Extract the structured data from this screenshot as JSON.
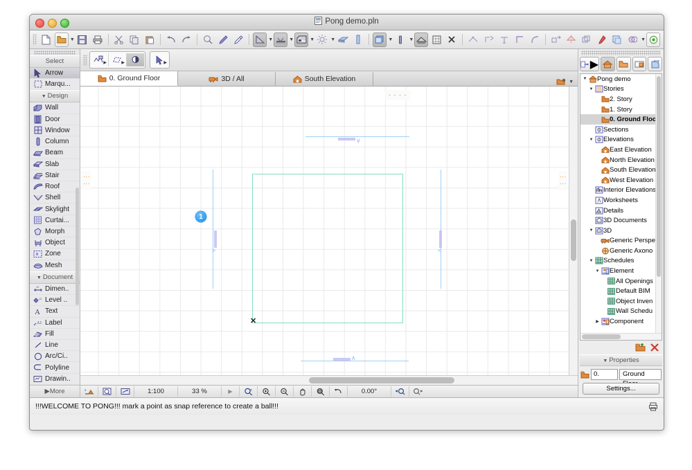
{
  "window": {
    "title": "Pong demo.pln",
    "doc_icon": "document-icon",
    "traffic": {
      "close": "close-button",
      "minimize": "minimize-button",
      "zoom": "zoom-button"
    }
  },
  "toolbar_main": [
    {
      "icon": "new-document-icon",
      "label": "New"
    },
    {
      "icon": "open-folder-icon",
      "label": "Open",
      "has_caret": true,
      "framed": true
    },
    {
      "icon": "save-icon",
      "label": "Save"
    },
    {
      "icon": "print-icon",
      "label": "Print"
    },
    {
      "icon": "scissors-icon",
      "label": "Cut"
    },
    {
      "icon": "copy-icon",
      "label": "Copy"
    },
    {
      "icon": "paste-icon",
      "label": "Paste"
    },
    {
      "icon": "undo-arrow-icon",
      "label": "Undo"
    },
    {
      "icon": "redo-arrow-icon",
      "label": "Redo"
    },
    {
      "icon": "find-select-icon",
      "label": "Find & Select"
    },
    {
      "icon": "pen-icon",
      "label": "Pick Up Parameters"
    },
    {
      "icon": "syringe-icon",
      "label": "Inject Parameters"
    },
    {
      "icon": "measure-icon",
      "label": "Measure",
      "has_caret": true,
      "active": true
    },
    {
      "icon": "dimension-icon",
      "label": "Dimension",
      "has_caret": true,
      "active": true
    },
    {
      "icon": "zone-stamp-icon",
      "label": "Zone",
      "has_caret": true,
      "active": true
    },
    {
      "icon": "sun-icon",
      "label": "Sun Settings",
      "has_caret": true
    },
    {
      "icon": "slab-blue-icon",
      "label": "Slab"
    },
    {
      "icon": "wall-blue-icon",
      "label": "Wall"
    },
    {
      "icon": "stack-3d-icon",
      "label": "3D View",
      "has_caret": true,
      "active": true
    },
    {
      "icon": "column-small-icon",
      "label": "Column",
      "has_caret": true
    },
    {
      "icon": "roof-tool-icon",
      "label": "Roof",
      "active": true
    },
    {
      "icon": "marquee-grid-icon",
      "label": "Marquee"
    },
    {
      "icon": "x-delete-icon",
      "label": "Delete"
    },
    {
      "icon": "trim-icon",
      "label": "Trim"
    },
    {
      "icon": "split-icon",
      "label": "Split"
    },
    {
      "icon": "adjust-icon",
      "label": "Adjust"
    },
    {
      "icon": "corner-icon",
      "label": "Intersect"
    },
    {
      "icon": "fillet-icon",
      "label": "Fillet/Chamfer"
    },
    {
      "icon": "drag-copy-icon",
      "label": "Drag a Copy"
    },
    {
      "icon": "mirror-house-icon",
      "label": "Mirror a Copy"
    },
    {
      "icon": "multiply-icon",
      "label": "Multiply"
    },
    {
      "icon": "pen-marker-icon",
      "label": "Display Order"
    },
    {
      "icon": "group-icon",
      "label": "Group"
    },
    {
      "icon": "solid-ops-icon",
      "label": "Solid Element Operations",
      "has_caret": true
    },
    {
      "icon": "target-green-icon",
      "label": "Align"
    }
  ],
  "mini_toolbar": [
    {
      "icon": "arrow-group-icon",
      "label": "Arrow Group",
      "has_caret": true
    },
    {
      "icon": "polygon-select-icon",
      "label": "Polygon Selection",
      "has_caret": true
    },
    {
      "icon": "fill-hand-icon",
      "label": "Paint Bucket",
      "on": true
    },
    {
      "icon": "cursor-arrow-icon",
      "label": "Arrow Tool",
      "has_caret": true,
      "framed": true
    }
  ],
  "toolbox": {
    "sections": [
      {
        "header": "Select",
        "items": [
          {
            "label": "Arrow",
            "icon": "arrow-cursor-icon",
            "selected": true
          },
          {
            "label": "Marqu...",
            "icon": "marquee-icon"
          }
        ]
      },
      {
        "header": "Design",
        "items": [
          {
            "label": "Wall",
            "icon": "wall-icon"
          },
          {
            "label": "Door",
            "icon": "door-icon"
          },
          {
            "label": "Window",
            "icon": "window-icon"
          },
          {
            "label": "Column",
            "icon": "column-icon"
          },
          {
            "label": "Beam",
            "icon": "beam-icon"
          },
          {
            "label": "Slab",
            "icon": "slab-icon"
          },
          {
            "label": "Stair",
            "icon": "stair-icon"
          },
          {
            "label": "Roof",
            "icon": "roof-icon"
          },
          {
            "label": "Shell",
            "icon": "shell-icon"
          },
          {
            "label": "Skylight",
            "icon": "skylight-icon"
          },
          {
            "label": "Curtai...",
            "icon": "curtain-wall-icon"
          },
          {
            "label": "Morph",
            "icon": "morph-icon"
          },
          {
            "label": "Object",
            "icon": "object-icon"
          },
          {
            "label": "Zone",
            "icon": "zone-icon"
          },
          {
            "label": "Mesh",
            "icon": "mesh-icon"
          }
        ]
      },
      {
        "header": "Document",
        "items": [
          {
            "label": "Dimen..",
            "icon": "dimension-tool-icon"
          },
          {
            "label": "Level ..",
            "icon": "level-dimension-icon"
          },
          {
            "label": "Text",
            "icon": "text-icon"
          },
          {
            "label": "Label",
            "icon": "label-icon"
          },
          {
            "label": "Fill",
            "icon": "fill-icon"
          },
          {
            "label": "Line",
            "icon": "line-icon"
          },
          {
            "label": "Arc/Ci..",
            "icon": "arc-circle-icon"
          },
          {
            "label": "Polyline",
            "icon": "polyline-icon"
          },
          {
            "label": "Drawin..",
            "icon": "drawing-icon"
          }
        ]
      }
    ],
    "more_label": "More"
  },
  "tabs": [
    {
      "label": "0. Ground Floor",
      "icon": "story-icon",
      "active": true
    },
    {
      "label": "3D / All",
      "icon": "camera-3d-icon",
      "active": false
    },
    {
      "label": "South Elevation",
      "icon": "elevation-house-icon",
      "active": false
    }
  ],
  "tab_extra": {
    "icon": "organizer-icon",
    "caret": "chevron-down-icon"
  },
  "canvas": {
    "marker_badge": "1",
    "elevation_marks": [
      "- - - -",
      "- - - -",
      "⋮",
      "⋮"
    ],
    "cursor": "x-snap-cursor"
  },
  "zoombar": {
    "buttons_left": [
      {
        "icon": "elevation-toggle-icon"
      },
      {
        "icon": "quick-layer-icon"
      },
      {
        "icon": "trace-reference-icon"
      }
    ],
    "scale": "1:100",
    "zoom_percent": "33 %",
    "play_icon": "play-triangle-icon",
    "nav_buttons": [
      {
        "icon": "zoom-fit-icon"
      },
      {
        "icon": "zoom-in-icon"
      },
      {
        "icon": "zoom-out-icon"
      },
      {
        "icon": "pan-hand-icon"
      },
      {
        "icon": "fit-in-window-icon"
      },
      {
        "icon": "previous-zoom-icon"
      }
    ],
    "orientation": "0.00°",
    "buttons_right": [
      {
        "icon": "zoom-prev-arrow-icon"
      },
      {
        "icon": "zoom-next-arrow-icon"
      }
    ]
  },
  "navigator": {
    "tabs": [
      {
        "icon": "navigator-arrow-icon",
        "caret": true,
        "selected": false
      },
      {
        "icon": "project-map-icon",
        "selected": true
      },
      {
        "icon": "view-map-icon",
        "selected": false
      },
      {
        "icon": "layout-book-icon",
        "selected": false
      },
      {
        "icon": "publisher-icon",
        "selected": false
      }
    ],
    "tree": [
      {
        "label": "Pong demo",
        "icon": "project-home-icon",
        "depth": 0,
        "twisty": "down"
      },
      {
        "label": "Stories",
        "icon": "stories-icon",
        "depth": 1,
        "twisty": "down"
      },
      {
        "label": "2. Story",
        "icon": "story-icon",
        "depth": 2
      },
      {
        "label": "1. Story",
        "icon": "story-icon",
        "depth": 2
      },
      {
        "label": "0. Ground Floo",
        "icon": "story-icon",
        "depth": 2,
        "selected": true
      },
      {
        "label": "Sections",
        "icon": "section-icon",
        "depth": 1
      },
      {
        "label": "Elevations",
        "icon": "elevation-icon",
        "depth": 1,
        "twisty": "down"
      },
      {
        "label": "East Elevation",
        "icon": "elevation-house-icon",
        "depth": 2
      },
      {
        "label": "North Elevation",
        "icon": "elevation-house-icon",
        "depth": 2
      },
      {
        "label": "South Elevation",
        "icon": "elevation-house-icon",
        "depth": 2
      },
      {
        "label": "West Elevation",
        "icon": "elevation-house-icon",
        "depth": 2
      },
      {
        "label": "Interior Elevations",
        "icon": "interior-elevation-icon",
        "depth": 1
      },
      {
        "label": "Worksheets",
        "icon": "worksheet-icon",
        "depth": 1
      },
      {
        "label": "Details",
        "icon": "detail-icon",
        "depth": 1
      },
      {
        "label": "3D Documents",
        "icon": "doc3d-icon",
        "depth": 1
      },
      {
        "label": "3D",
        "icon": "threed-icon",
        "depth": 1,
        "twisty": "down"
      },
      {
        "label": "Generic Perspe",
        "icon": "camera-3d-icon",
        "depth": 2
      },
      {
        "label": "Generic Axono",
        "icon": "axono-icon",
        "depth": 2
      },
      {
        "label": "Schedules",
        "icon": "schedule-icon",
        "depth": 1,
        "twisty": "down"
      },
      {
        "label": "Element",
        "icon": "element-schedule-icon",
        "depth": 2,
        "twisty": "down"
      },
      {
        "label": "All Openings",
        "icon": "table-icon",
        "depth": 3
      },
      {
        "label": "Default BIM",
        "icon": "table-icon",
        "depth": 3
      },
      {
        "label": "Object Inven",
        "icon": "table-icon",
        "depth": 3
      },
      {
        "label": "Wall Schedu",
        "icon": "table-icon",
        "depth": 3
      },
      {
        "label": "Component",
        "icon": "component-schedule-icon",
        "depth": 2,
        "twisty": "right"
      }
    ],
    "actions": [
      {
        "icon": "new-folder-icon"
      },
      {
        "icon": "delete-x-icon"
      }
    ],
    "properties": {
      "header": "Properties",
      "number": "0.",
      "name": "Ground Floor",
      "settings_label": "Settings..."
    }
  },
  "status": {
    "message": "!!!WELCOME TO PONG!!! mark a point as snap reference to create a ball!!!",
    "right_icon": "printer-icon"
  },
  "colors": {
    "wall_blue": "#9fd0f5",
    "door_purple": "#c3c0f0",
    "zone_teal": "#86ddc4",
    "elev_orange": "#f0992e",
    "badge_blue": "#1a8fe8",
    "grid_gray": "#e9e9e9"
  }
}
